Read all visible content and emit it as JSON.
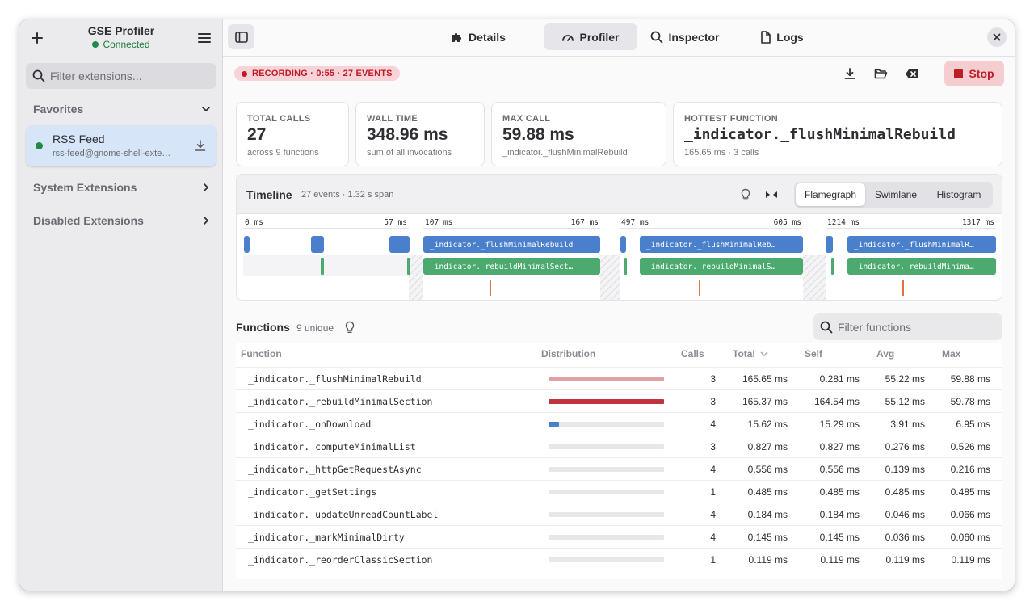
{
  "sidebar": {
    "title": "GSE Profiler",
    "status": "Connected",
    "search_placeholder": "Filter extensions...",
    "favorites_label": "Favorites",
    "favorite_extension": {
      "name": "RSS Feed",
      "uuid": "rss-feed@gnome-shell-exte…"
    },
    "system_label": "System Extensions",
    "disabled_label": "Disabled Extensions"
  },
  "tabs": [
    {
      "label": "Details",
      "icon": "puzzle-icon"
    },
    {
      "label": "Profiler",
      "icon": "gauge-icon",
      "active": true
    },
    {
      "label": "Inspector",
      "icon": "search-icon"
    },
    {
      "label": "Logs",
      "icon": "document-icon"
    }
  ],
  "toolbar": {
    "recording_label": "RECORDING · 0:55 · 27 EVENTS",
    "stop_label": "Stop",
    "colors": {
      "danger": "#c01c28",
      "accent": "#4a7fcb",
      "green": "#4caa6f"
    }
  },
  "stats": {
    "total_calls": {
      "label": "TOTAL CALLS",
      "value": "27",
      "sub": "across 9 functions"
    },
    "wall_time": {
      "label": "WALL TIME",
      "value": "348.96 ms",
      "sub": "sum of all invocations"
    },
    "max_call": {
      "label": "MAX CALL",
      "value": "59.88 ms",
      "sub": "_indicator._flushMinimalRebuild"
    },
    "hottest": {
      "label": "HOTTEST FUNCTION",
      "value": "_indicator._flushMinimalRebuild",
      "sub": "165.65 ms · 3 calls"
    }
  },
  "timeline": {
    "title": "Timeline",
    "sub": "27 events · 1.32 s span",
    "modes": [
      "Flamegraph",
      "Swimlane",
      "Histogram"
    ],
    "active_mode": "Flamegraph",
    "ticks": [
      {
        "start": "0 ms",
        "end": "57 ms"
      },
      {
        "start": "107 ms",
        "end": "167 ms"
      },
      {
        "start": "497 ms",
        "end": "605 ms"
      },
      {
        "start": "1214 ms",
        "end": "1317 ms"
      }
    ],
    "bar_labels": {
      "flush_1": "_indicator._flushMinimalRebuild",
      "flush_2": "_indicator._flushMinimalReb…",
      "flush_3": "_indicator._flushMinimalR…",
      "rebuild_1": "_indicator._rebuildMinimalSect…",
      "rebuild_2": "_indicator._rebuildMinimalS…",
      "rebuild_3": "_indicator._rebuildMinima…"
    }
  },
  "functions": {
    "title": "Functions",
    "sub": "9 unique",
    "search_placeholder": "Filter functions",
    "columns": {
      "function": "Function",
      "distribution": "Distribution",
      "calls": "Calls",
      "total": "Total",
      "self": "Self",
      "avg": "Avg",
      "max": "Max"
    },
    "rows": [
      {
        "name": "_indicator._flushMinimalRebuild",
        "calls": "3",
        "total": "165.65 ms",
        "self": "0.281 ms",
        "avg": "55.22 ms",
        "max": "59.88 ms",
        "dist": 1.0,
        "dist_color": "#e0a0a8"
      },
      {
        "name": "_indicator._rebuildMinimalSection",
        "calls": "3",
        "total": "165.37 ms",
        "self": "164.54 ms",
        "avg": "55.12 ms",
        "max": "59.78 ms",
        "dist": 0.998,
        "dist_color": "#c0343f"
      },
      {
        "name": "_indicator._onDownload",
        "calls": "4",
        "total": "15.62 ms",
        "self": "15.29 ms",
        "avg": "3.91 ms",
        "max": "6.95 ms",
        "dist": 0.094,
        "dist_color": "#4a7fcb"
      },
      {
        "name": "_indicator._computeMinimalList",
        "calls": "3",
        "total": "0.827 ms",
        "self": "0.827 ms",
        "avg": "0.276 ms",
        "max": "0.526 ms",
        "dist": 0.005,
        "dist_color": "#9a9aa2"
      },
      {
        "name": "_indicator._httpGetRequestAsync",
        "calls": "4",
        "total": "0.556 ms",
        "self": "0.556 ms",
        "avg": "0.139 ms",
        "max": "0.216 ms",
        "dist": 0.0034,
        "dist_color": "#9a9aa2"
      },
      {
        "name": "_indicator._getSettings",
        "calls": "1",
        "total": "0.485 ms",
        "self": "0.485 ms",
        "avg": "0.485 ms",
        "max": "0.485 ms",
        "dist": 0.0029,
        "dist_color": "#9a9aa2"
      },
      {
        "name": "_indicator._updateUnreadCountLabel",
        "calls": "4",
        "total": "0.184 ms",
        "self": "0.184 ms",
        "avg": "0.046 ms",
        "max": "0.066 ms",
        "dist": 0.0011,
        "dist_color": "#9a9aa2"
      },
      {
        "name": "_indicator._markMinimalDirty",
        "calls": "4",
        "total": "0.145 ms",
        "self": "0.145 ms",
        "avg": "0.036 ms",
        "max": "0.060 ms",
        "dist": 0.0009,
        "dist_color": "#9a9aa2"
      },
      {
        "name": "_indicator._reorderClassicSection",
        "calls": "1",
        "total": "0.119 ms",
        "self": "0.119 ms",
        "avg": "0.119 ms",
        "max": "0.119 ms",
        "dist": 0.0007,
        "dist_color": "#9a9aa2"
      }
    ]
  }
}
